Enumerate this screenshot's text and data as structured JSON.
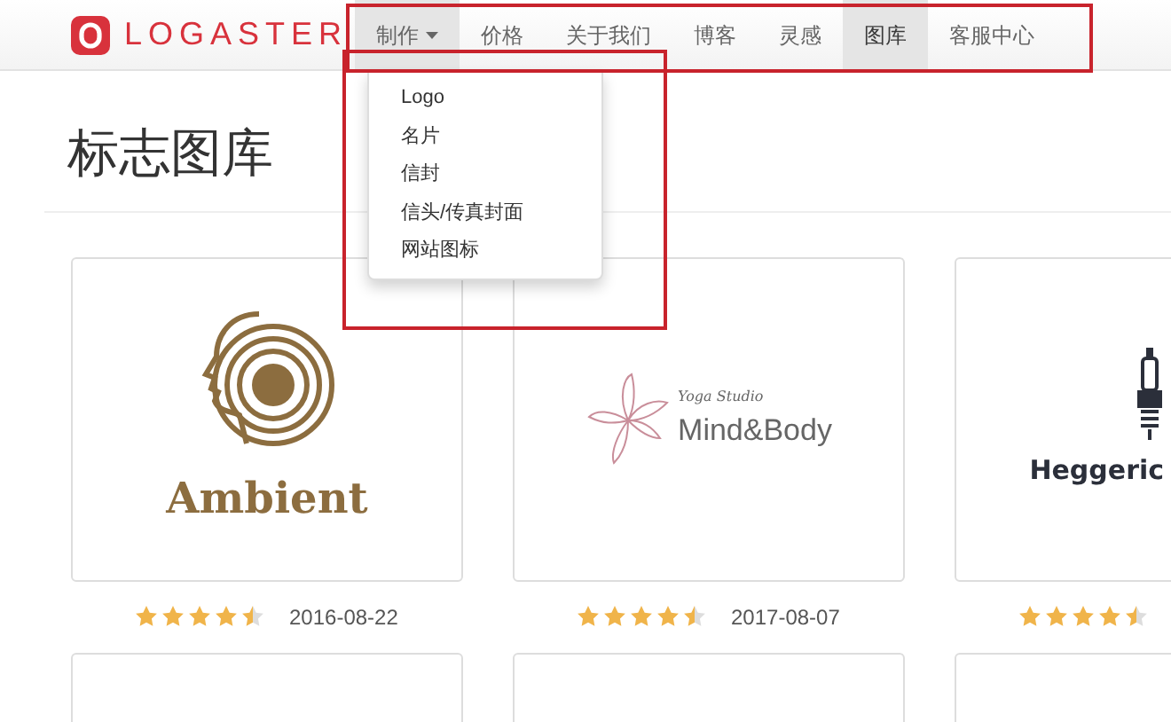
{
  "header": {
    "logo_text": "LOGASTER"
  },
  "nav": [
    {
      "label": "制作",
      "kind": "dropdown",
      "expanded": true,
      "selected": false
    },
    {
      "label": "价格",
      "kind": "link",
      "selected": false
    },
    {
      "label": "关于我们",
      "kind": "link",
      "selected": false
    },
    {
      "label": "博客",
      "kind": "link",
      "selected": false
    },
    {
      "label": "灵感",
      "kind": "link",
      "selected": false
    },
    {
      "label": "图库",
      "kind": "link",
      "selected": true
    },
    {
      "label": "客服中心",
      "kind": "link",
      "selected": false
    }
  ],
  "dropdown_menu": [
    "Logo",
    "名片",
    "信封",
    "信头/传真封面",
    "网站图标"
  ],
  "page_title": "标志图库",
  "gallery": [
    {
      "kind": "ambient",
      "logo_texts": [
        "Ambient"
      ],
      "stars": 4.5,
      "date": "2016-08-22"
    },
    {
      "kind": "lotus",
      "logo_texts": [
        "Yoga Studio",
        "Mind&Body"
      ],
      "stars": 4.5,
      "date": "2017-08-07"
    },
    {
      "kind": "sparkplug",
      "logo_texts": [
        "Heggeric"
      ],
      "stars": 4.5
    },
    {
      "kind": "blank"
    },
    {
      "kind": "blank"
    },
    {
      "kind": "blank"
    }
  ],
  "annotations": {
    "nav_framed": true,
    "dropdown_framed": true
  }
}
